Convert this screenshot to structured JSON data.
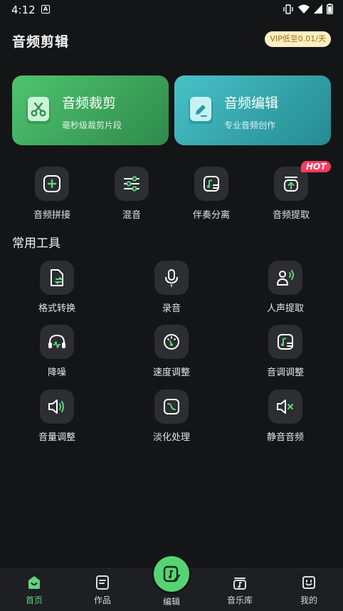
{
  "status": {
    "time": "4:12",
    "notif_letter": "A"
  },
  "header": {
    "title": "音频剪辑",
    "vip": "VIP低至0.01/天"
  },
  "hero": [
    {
      "title": "音频裁剪",
      "subtitle": "毫秒级裁剪片段",
      "icon": "scissors-icon"
    },
    {
      "title": "音频编辑",
      "subtitle": "专业音频创作",
      "icon": "pencil-icon"
    }
  ],
  "quick": [
    {
      "label": "音频拼接",
      "icon": "plus-box-icon"
    },
    {
      "label": "混音",
      "icon": "sliders-icon"
    },
    {
      "label": "伴奏分离",
      "icon": "music-separate-icon"
    },
    {
      "label": "音频提取",
      "icon": "extract-icon",
      "badge": "HOT"
    }
  ],
  "section": {
    "title": "常用工具"
  },
  "tools": [
    {
      "label": "格式转换",
      "icon": "file-convert-icon"
    },
    {
      "label": "录音",
      "icon": "microphone-icon"
    },
    {
      "label": "人声提取",
      "icon": "voice-extract-icon"
    },
    {
      "label": "降噪",
      "icon": "headphones-icon"
    },
    {
      "label": "速度调整",
      "icon": "speedometer-icon"
    },
    {
      "label": "音调调整",
      "icon": "pitch-icon"
    },
    {
      "label": "音量调整",
      "icon": "volume-icon"
    },
    {
      "label": "淡化处理",
      "icon": "fade-icon"
    },
    {
      "label": "静音音频",
      "icon": "mute-icon"
    }
  ],
  "nav": {
    "home": "首页",
    "works": "作品",
    "edit": "编辑",
    "library": "音乐库",
    "mine": "我的"
  },
  "colors": {
    "accent": "#55d473",
    "hot": "#ff3a5e",
    "vip_bg": "#fdf0c4"
  }
}
